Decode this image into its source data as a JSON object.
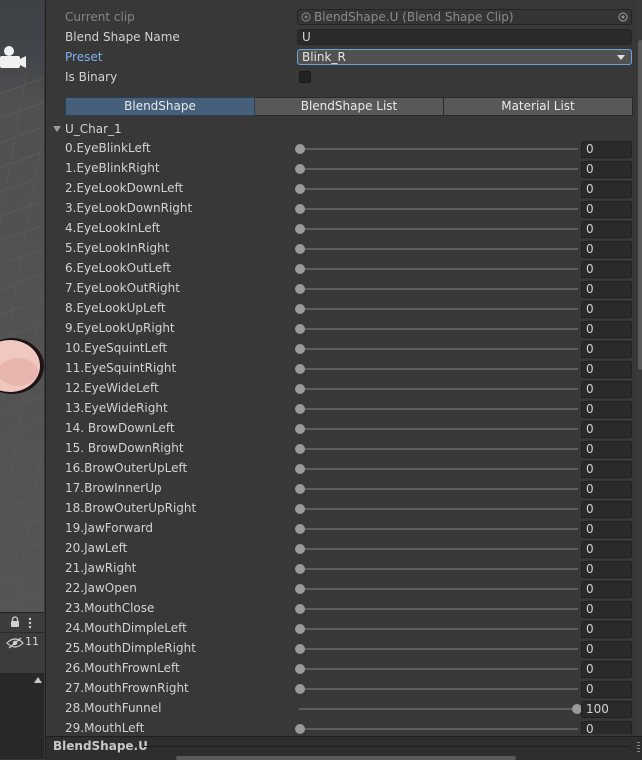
{
  "scene_panel": {
    "visible_count": "11"
  },
  "inspector": {
    "current_clip_label": "Current clip",
    "current_clip_value": "BlendShape.U (Blend Shape Clip)",
    "blend_shape_name_label": "Blend Shape Name",
    "blend_shape_name_value": "U",
    "preset_label": "Preset",
    "preset_value": "Blink_R",
    "is_binary_label": "Is Binary",
    "is_binary_checked": false,
    "tabs": [
      {
        "label": "BlendShape",
        "active": true
      },
      {
        "label": "BlendShape List",
        "active": false
      },
      {
        "label": "Material List",
        "active": false
      }
    ],
    "mesh_name": "U_Char_1",
    "slider_range": [
      0,
      100
    ],
    "blendshapes": [
      {
        "label": "0.EyeBlinkLeft",
        "value": "0"
      },
      {
        "label": "1.EyeBlinkRight",
        "value": "0"
      },
      {
        "label": "2.EyeLookDownLeft",
        "value": "0"
      },
      {
        "label": "3.EyeLookDownRight",
        "value": "0"
      },
      {
        "label": "4.EyeLookInLeft",
        "value": "0"
      },
      {
        "label": "5.EyeLookInRight",
        "value": "0"
      },
      {
        "label": "6.EyeLookOutLeft",
        "value": "0"
      },
      {
        "label": "7.EyeLookOutRight",
        "value": "0"
      },
      {
        "label": "8.EyeLookUpLeft",
        "value": "0"
      },
      {
        "label": "9.EyeLookUpRight",
        "value": "0"
      },
      {
        "label": "10.EyeSquintLeft",
        "value": "0"
      },
      {
        "label": "11.EyeSquintRight",
        "value": "0"
      },
      {
        "label": "12.EyeWideLeft",
        "value": "0"
      },
      {
        "label": "13.EyeWideRight",
        "value": "0"
      },
      {
        "label": "14. BrowDownLeft",
        "value": "0"
      },
      {
        "label": "15. BrowDownRight",
        "value": "0"
      },
      {
        "label": "16.BrowOuterUpLeft",
        "value": "0"
      },
      {
        "label": "17.BrowInnerUp",
        "value": "0"
      },
      {
        "label": "18.BrowOuterUpRight",
        "value": "0"
      },
      {
        "label": "19.JawForward",
        "value": "0"
      },
      {
        "label": "20.JawLeft",
        "value": "0"
      },
      {
        "label": "21.JawRight",
        "value": "0"
      },
      {
        "label": "22.JawOpen",
        "value": "0"
      },
      {
        "label": "23.MouthClose",
        "value": "0"
      },
      {
        "label": "24.MouthDimpleLeft",
        "value": "0"
      },
      {
        "label": "25.MouthDimpleRight",
        "value": "0"
      },
      {
        "label": "26.MouthFrownLeft",
        "value": "0"
      },
      {
        "label": "27.MouthFrownRight",
        "value": "0"
      },
      {
        "label": "28.MouthFunnel",
        "value": "100"
      },
      {
        "label": "29.MouthLeft",
        "value": "0"
      }
    ]
  },
  "preview": {
    "title": "BlendShape.U"
  }
}
